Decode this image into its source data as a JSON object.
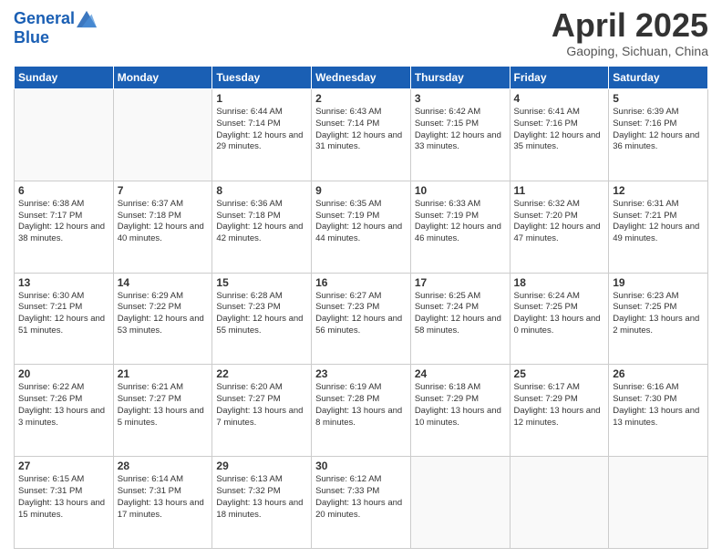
{
  "header": {
    "logo_line1": "General",
    "logo_line2": "Blue",
    "month_title": "April 2025",
    "location": "Gaoping, Sichuan, China"
  },
  "days_of_week": [
    "Sunday",
    "Monday",
    "Tuesday",
    "Wednesday",
    "Thursday",
    "Friday",
    "Saturday"
  ],
  "weeks": [
    [
      {
        "day": "",
        "info": ""
      },
      {
        "day": "",
        "info": ""
      },
      {
        "day": "1",
        "info": "Sunrise: 6:44 AM\nSunset: 7:14 PM\nDaylight: 12 hours and 29 minutes."
      },
      {
        "day": "2",
        "info": "Sunrise: 6:43 AM\nSunset: 7:14 PM\nDaylight: 12 hours and 31 minutes."
      },
      {
        "day": "3",
        "info": "Sunrise: 6:42 AM\nSunset: 7:15 PM\nDaylight: 12 hours and 33 minutes."
      },
      {
        "day": "4",
        "info": "Sunrise: 6:41 AM\nSunset: 7:16 PM\nDaylight: 12 hours and 35 minutes."
      },
      {
        "day": "5",
        "info": "Sunrise: 6:39 AM\nSunset: 7:16 PM\nDaylight: 12 hours and 36 minutes."
      }
    ],
    [
      {
        "day": "6",
        "info": "Sunrise: 6:38 AM\nSunset: 7:17 PM\nDaylight: 12 hours and 38 minutes."
      },
      {
        "day": "7",
        "info": "Sunrise: 6:37 AM\nSunset: 7:18 PM\nDaylight: 12 hours and 40 minutes."
      },
      {
        "day": "8",
        "info": "Sunrise: 6:36 AM\nSunset: 7:18 PM\nDaylight: 12 hours and 42 minutes."
      },
      {
        "day": "9",
        "info": "Sunrise: 6:35 AM\nSunset: 7:19 PM\nDaylight: 12 hours and 44 minutes."
      },
      {
        "day": "10",
        "info": "Sunrise: 6:33 AM\nSunset: 7:19 PM\nDaylight: 12 hours and 46 minutes."
      },
      {
        "day": "11",
        "info": "Sunrise: 6:32 AM\nSunset: 7:20 PM\nDaylight: 12 hours and 47 minutes."
      },
      {
        "day": "12",
        "info": "Sunrise: 6:31 AM\nSunset: 7:21 PM\nDaylight: 12 hours and 49 minutes."
      }
    ],
    [
      {
        "day": "13",
        "info": "Sunrise: 6:30 AM\nSunset: 7:21 PM\nDaylight: 12 hours and 51 minutes."
      },
      {
        "day": "14",
        "info": "Sunrise: 6:29 AM\nSunset: 7:22 PM\nDaylight: 12 hours and 53 minutes."
      },
      {
        "day": "15",
        "info": "Sunrise: 6:28 AM\nSunset: 7:23 PM\nDaylight: 12 hours and 55 minutes."
      },
      {
        "day": "16",
        "info": "Sunrise: 6:27 AM\nSunset: 7:23 PM\nDaylight: 12 hours and 56 minutes."
      },
      {
        "day": "17",
        "info": "Sunrise: 6:25 AM\nSunset: 7:24 PM\nDaylight: 12 hours and 58 minutes."
      },
      {
        "day": "18",
        "info": "Sunrise: 6:24 AM\nSunset: 7:25 PM\nDaylight: 13 hours and 0 minutes."
      },
      {
        "day": "19",
        "info": "Sunrise: 6:23 AM\nSunset: 7:25 PM\nDaylight: 13 hours and 2 minutes."
      }
    ],
    [
      {
        "day": "20",
        "info": "Sunrise: 6:22 AM\nSunset: 7:26 PM\nDaylight: 13 hours and 3 minutes."
      },
      {
        "day": "21",
        "info": "Sunrise: 6:21 AM\nSunset: 7:27 PM\nDaylight: 13 hours and 5 minutes."
      },
      {
        "day": "22",
        "info": "Sunrise: 6:20 AM\nSunset: 7:27 PM\nDaylight: 13 hours and 7 minutes."
      },
      {
        "day": "23",
        "info": "Sunrise: 6:19 AM\nSunset: 7:28 PM\nDaylight: 13 hours and 8 minutes."
      },
      {
        "day": "24",
        "info": "Sunrise: 6:18 AM\nSunset: 7:29 PM\nDaylight: 13 hours and 10 minutes."
      },
      {
        "day": "25",
        "info": "Sunrise: 6:17 AM\nSunset: 7:29 PM\nDaylight: 13 hours and 12 minutes."
      },
      {
        "day": "26",
        "info": "Sunrise: 6:16 AM\nSunset: 7:30 PM\nDaylight: 13 hours and 13 minutes."
      }
    ],
    [
      {
        "day": "27",
        "info": "Sunrise: 6:15 AM\nSunset: 7:31 PM\nDaylight: 13 hours and 15 minutes."
      },
      {
        "day": "28",
        "info": "Sunrise: 6:14 AM\nSunset: 7:31 PM\nDaylight: 13 hours and 17 minutes."
      },
      {
        "day": "29",
        "info": "Sunrise: 6:13 AM\nSunset: 7:32 PM\nDaylight: 13 hours and 18 minutes."
      },
      {
        "day": "30",
        "info": "Sunrise: 6:12 AM\nSunset: 7:33 PM\nDaylight: 13 hours and 20 minutes."
      },
      {
        "day": "",
        "info": ""
      },
      {
        "day": "",
        "info": ""
      },
      {
        "day": "",
        "info": ""
      }
    ]
  ]
}
